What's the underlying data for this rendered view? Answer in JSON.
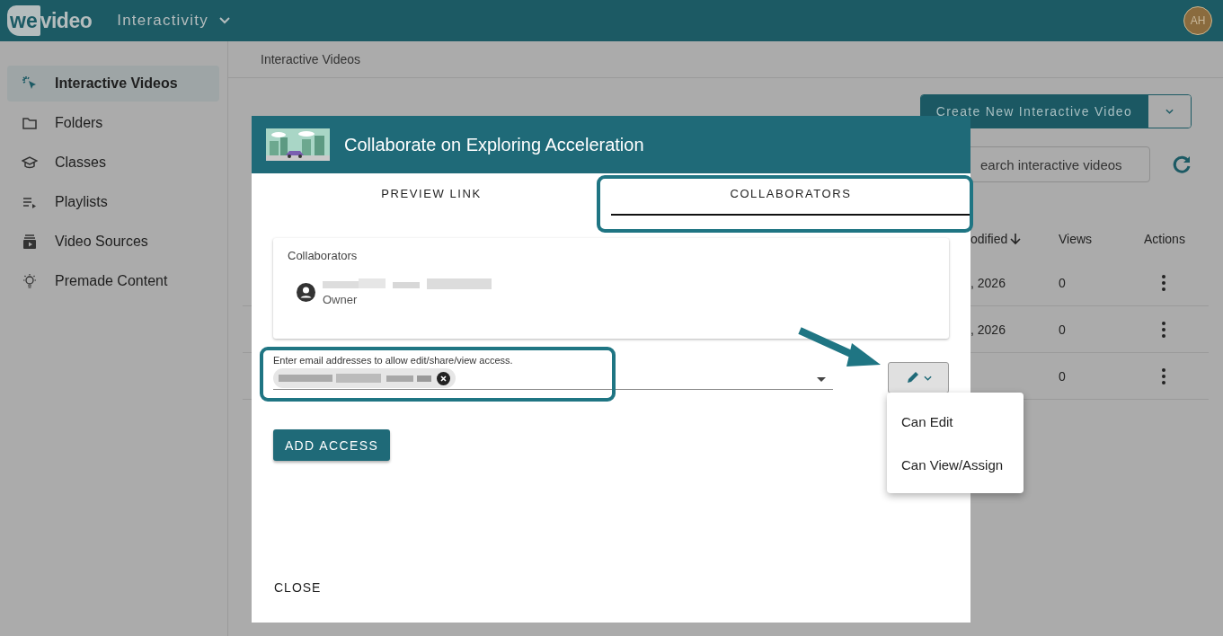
{
  "app": {
    "logo": "wevideo",
    "product": "Interactivity",
    "avatar": "AH"
  },
  "sidebar": {
    "items": [
      {
        "label": "Interactive Videos",
        "selected": true
      },
      {
        "label": "Folders",
        "selected": false
      },
      {
        "label": "Classes",
        "selected": false
      },
      {
        "label": "Playlists",
        "selected": false
      },
      {
        "label": "Video Sources",
        "selected": false
      },
      {
        "label": "Premade Content",
        "selected": false
      }
    ]
  },
  "breadcrumb": "Interactive Videos",
  "toolbar": {
    "create_button": "Create New Interactive Video",
    "search": {
      "placeholder": "earch interactive videos"
    }
  },
  "table": {
    "columns": [
      {
        "label": "odified",
        "sorted": true
      },
      {
        "label": "Views",
        "sorted": false
      },
      {
        "label": "Actions",
        "sorted": false
      }
    ],
    "rows": [
      {
        "modified": ", 2026",
        "views": "0"
      },
      {
        "modified": ", 2026",
        "views": "0"
      },
      {
        "views": "0"
      }
    ]
  },
  "dialog": {
    "title": "Collaborate on Exploring Acceleration",
    "tabs": [
      {
        "label": "PREVIEW LINK",
        "selected": false
      },
      {
        "label": "COLLABORATORS",
        "selected": true
      }
    ],
    "collaborators": {
      "heading": "Collaborators",
      "people": [
        {
          "role": "Owner"
        }
      ]
    },
    "email_field": {
      "label": "Enter email addresses to allow edit/share/view access.",
      "chips": [
        {
          "kind": "redacted"
        }
      ]
    },
    "permission_menu": {
      "items": [
        {
          "label": "Can Edit"
        },
        {
          "label": "Can View/Assign"
        }
      ]
    },
    "add_button": "ADD ACCESS",
    "close_button": "CLOSE"
  }
}
